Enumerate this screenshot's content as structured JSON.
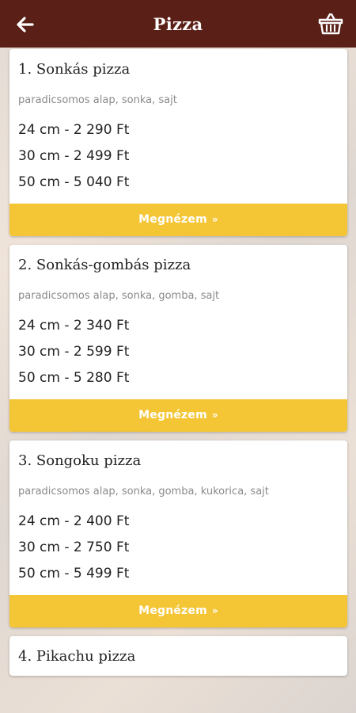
{
  "header": {
    "title": "Pizza"
  },
  "pizzas": [
    {
      "name": "1. Sonkás pizza",
      "ingredients": "paradicsomos alap, sonka, sajt",
      "prices": [
        "24 cm - 2 290 Ft",
        "30 cm - 2 499 Ft",
        "50 cm - 5 040 Ft"
      ],
      "cta": "Megnézem"
    },
    {
      "name": "2. Sonkás-gombás pizza",
      "ingredients": "paradicsomos alap, sonka, gomba, sajt",
      "prices": [
        "24 cm - 2 340 Ft",
        "30 cm - 2 599 Ft",
        "50 cm - 5 280 Ft"
      ],
      "cta": "Megnézem"
    },
    {
      "name": "3. Songoku pizza",
      "ingredients": "paradicsomos alap, sonka, gomba, kukorica, sajt",
      "prices": [
        "24 cm - 2 400 Ft",
        "30 cm - 2 750 Ft",
        "50 cm - 5 499 Ft"
      ],
      "cta": "Megnézem"
    },
    {
      "name": "4. Pikachu pizza"
    }
  ],
  "cta_arrow": "»",
  "colors": {
    "header": "#5a1f16",
    "cta": "#f4c534"
  },
  "icons": {
    "back": "arrow-left-icon",
    "cart": "shopping-basket-icon"
  }
}
